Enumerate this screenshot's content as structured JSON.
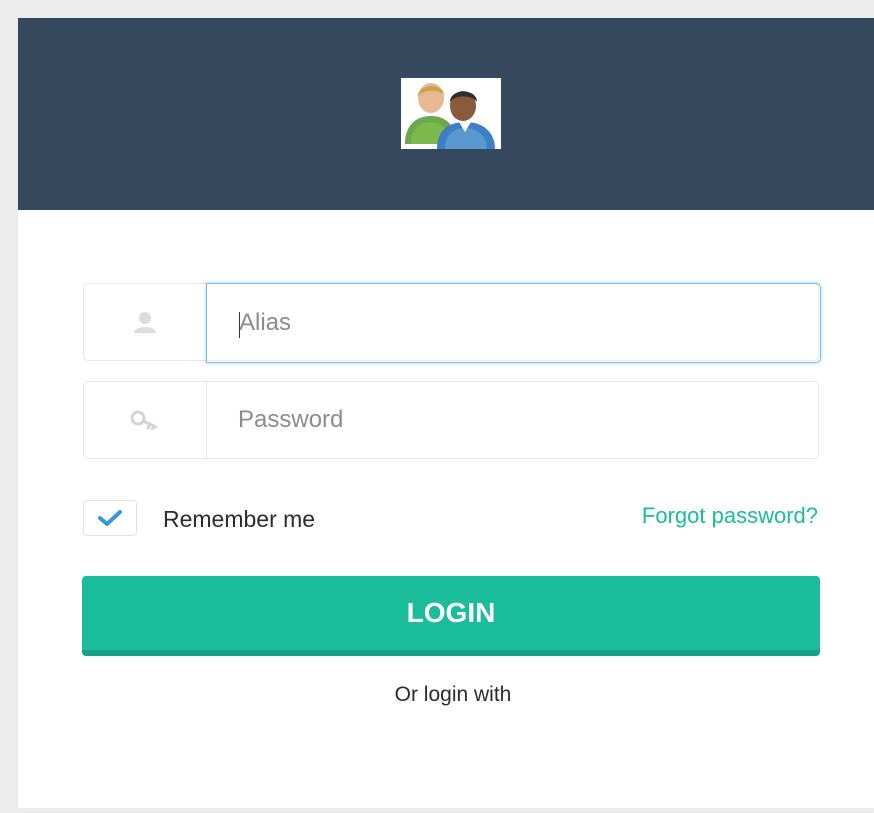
{
  "login_form": {
    "alias_placeholder": "Alias",
    "password_placeholder": "Password",
    "remember_label": "Remember me",
    "remember_checked": true,
    "forgot_label": "Forgot password?",
    "login_label": "LOGIN",
    "or_login_label": "Or login with"
  },
  "icons": {
    "header_avatar": "users-avatar-icon",
    "alias_addon": "user-icon",
    "password_addon": "key-icon",
    "checkbox_mark": "checkmark-icon"
  },
  "colors": {
    "header_bg": "#34495e",
    "accent": "#1abc9c",
    "accent_dark": "#16a085",
    "checkmark": "#3498db",
    "focus_border": "#7fb9e6"
  }
}
